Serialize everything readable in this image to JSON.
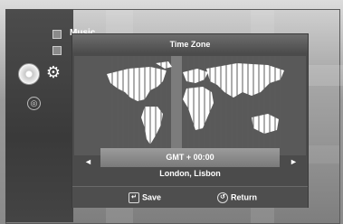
{
  "menu": {
    "items": [
      {
        "label": "Music",
        "icon": "music-icon"
      }
    ]
  },
  "dialog": {
    "title": "Time Zone",
    "gmt_value": "GMT + 00:00",
    "city": "London, Lisbon",
    "left_arrow": "◄",
    "right_arrow": "►",
    "buttons": {
      "save": "Save",
      "return": "Return"
    }
  },
  "colors": {
    "dialog_bg": "#4b4b4b",
    "map_land": "#ffffff",
    "highlight_band": "#7c7c7c",
    "gmt_bar": "#8a8a8a"
  }
}
